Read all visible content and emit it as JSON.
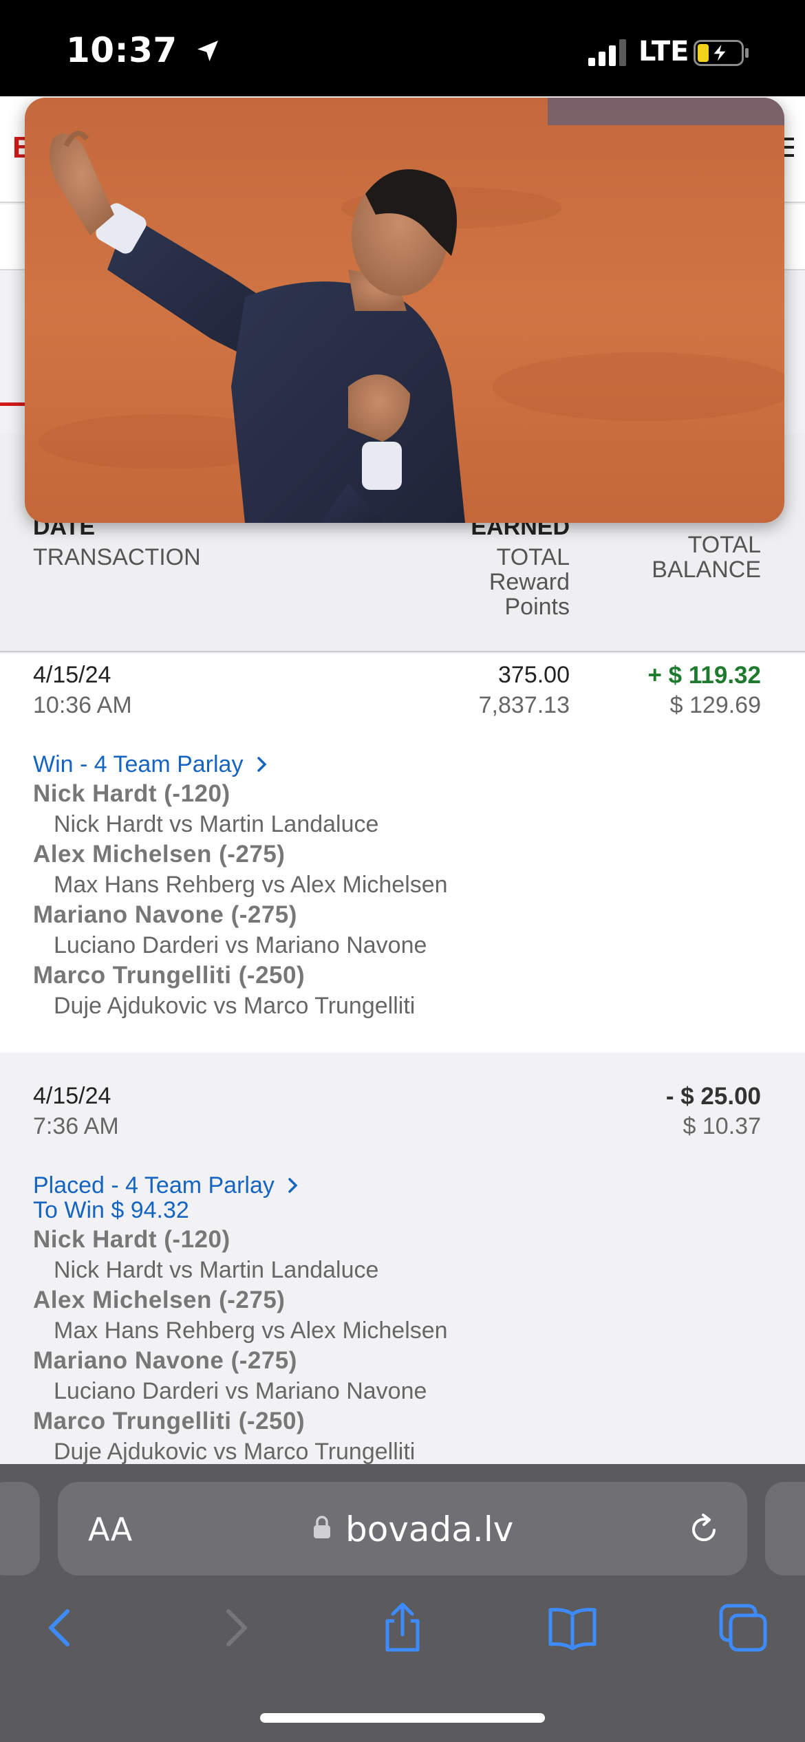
{
  "status_bar": {
    "time": "10:37",
    "network": "LTE"
  },
  "site": {
    "logo_letter": "B"
  },
  "table_header": {
    "date": "DATE",
    "transaction": "TRANSACTION",
    "earned": "EARNED",
    "total_reward_points": "TOTAL\nReward\nPoints",
    "total_balance": "TOTAL\nBALANCE"
  },
  "transactions": [
    {
      "date": "4/15/24",
      "time": "10:36 AM",
      "earned": "375.00",
      "total_reward_points": "7,837.13",
      "amount": "+ $ 119.32",
      "balance": "$ 129.69",
      "link": "Win - 4 Team Parlay",
      "legs": [
        {
          "pick": "Nick Hardt (-120)",
          "match": "Nick Hardt vs Martin Landaluce"
        },
        {
          "pick": "Alex Michelsen (-275)",
          "match": "Max Hans Rehberg vs Alex Michelsen"
        },
        {
          "pick": "Mariano Navone (-275)",
          "match": "Luciano Darderi vs Mariano Navone"
        },
        {
          "pick": "Marco Trungelliti (-250)",
          "match": "Duje Ajdukovic vs Marco Trungelliti"
        }
      ]
    },
    {
      "date": "4/15/24",
      "time": "7:36 AM",
      "amount": "- $ 25.00",
      "balance": "$ 10.37",
      "link": "Placed - 4 Team Parlay",
      "to_win": "To Win $ 94.32",
      "legs": [
        {
          "pick": "Nick Hardt (-120)",
          "match": "Nick Hardt vs Martin Landaluce"
        },
        {
          "pick": "Alex Michelsen (-275)",
          "match": "Max Hans Rehberg vs Alex Michelsen"
        },
        {
          "pick": "Mariano Navone (-275)",
          "match": "Luciano Darderi vs Mariano Navone"
        },
        {
          "pick": "Marco Trungelliti (-250)",
          "match": "Duje Ajdukovic vs Marco Trungelliti"
        }
      ]
    }
  ],
  "browser": {
    "text_size_button": "AA",
    "url": "bovada.lv"
  },
  "colors": {
    "win_green": "#1e7a2c",
    "link_blue": "#1565c0",
    "brand_red": "#d11a1a",
    "browser_bar": "#5b5b5e",
    "ios_blue": "#3d8bff"
  },
  "icons": [
    "location-arrow-icon",
    "signal-icon",
    "battery-charging-icon",
    "lock-icon",
    "reload-icon",
    "back-icon",
    "forward-icon",
    "share-icon",
    "bookmarks-icon",
    "tabs-icon",
    "menu-icon",
    "chevron-right-icon"
  ]
}
